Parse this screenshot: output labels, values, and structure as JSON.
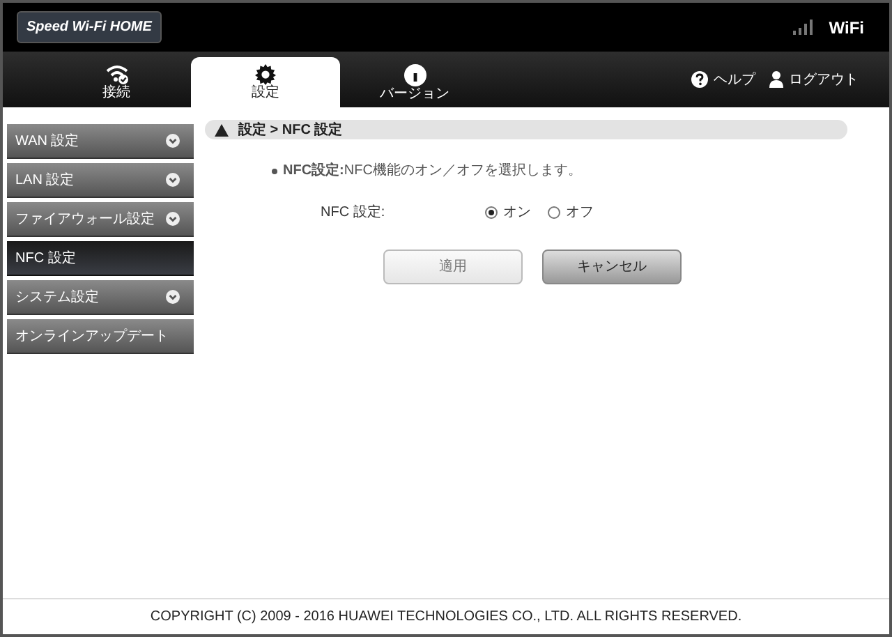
{
  "header": {
    "logo": "Speed Wi-Fi HOME",
    "wifi_badge": "WiFi"
  },
  "tabs": [
    {
      "label": "接続",
      "selected": false
    },
    {
      "label": "設定",
      "selected": true
    },
    {
      "label": "バージョン",
      "selected": false
    }
  ],
  "top_links": [
    "ヘルプ",
    "ログアウト"
  ],
  "sidebar": {
    "items": [
      {
        "label": "WAN 設定",
        "selected": false,
        "expandable": true
      },
      {
        "label": "LAN 設定",
        "selected": false,
        "expandable": true
      },
      {
        "label": "ファイアウォール設定",
        "selected": false,
        "expandable": true
      },
      {
        "label": "NFC 設定",
        "selected": true,
        "expandable": false
      },
      {
        "label": "システム設定",
        "selected": false,
        "expandable": true
      },
      {
        "label": "オンラインアップデート",
        "selected": false,
        "expandable": false
      }
    ]
  },
  "breadcrumb": "設定 > NFC 設定",
  "description": "**NFC設定:**NFC機能のオン／オフを選択します。",
  "nfc_setting": {
    "label": "NFC 設定:",
    "options": [
      {
        "label": "オン",
        "selected": true
      },
      {
        "label": "オフ",
        "selected": false
      }
    ]
  },
  "buttons": [
    {
      "label": "適用",
      "disabled": true
    },
    {
      "label": "キャンセル",
      "disabled": false
    }
  ],
  "footer": "COPYRIGHT (C) 2009 - 2016 HUAWEI TECHNOLOGIES CO., LTD. ALL RIGHTS RESERVED."
}
